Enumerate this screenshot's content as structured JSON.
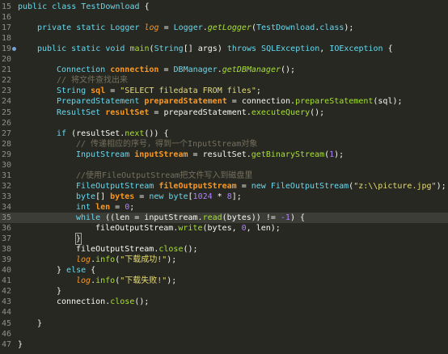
{
  "editor": {
    "language": "java",
    "current_line_number": "35",
    "breakpoint_line_number": "19",
    "lines": [
      {
        "num": "15",
        "indent": 0,
        "tokens": [
          [
            "kw",
            "public"
          ],
          [
            "pl",
            " "
          ],
          [
            "kw",
            "class"
          ],
          [
            "pl",
            " "
          ],
          [
            "cls",
            "TestDownload"
          ],
          [
            "pl",
            " {"
          ]
        ]
      },
      {
        "num": "16",
        "indent": 0,
        "tokens": []
      },
      {
        "num": "17",
        "indent": 1,
        "tokens": [
          [
            "kw",
            "private"
          ],
          [
            "pl",
            " "
          ],
          [
            "kw",
            "static"
          ],
          [
            "pl",
            " "
          ],
          [
            "ty",
            "Logger"
          ],
          [
            "pl",
            " "
          ],
          [
            "fld",
            "log"
          ],
          [
            "pl",
            " = "
          ],
          [
            "ty",
            "Logger"
          ],
          [
            "pl",
            "."
          ],
          [
            "sfn",
            "getLogger"
          ],
          [
            "pl",
            "("
          ],
          [
            "ty",
            "TestDownload"
          ],
          [
            "pl",
            "."
          ],
          [
            "kw",
            "class"
          ],
          [
            "pl",
            ");"
          ]
        ]
      },
      {
        "num": "18",
        "indent": 0,
        "tokens": []
      },
      {
        "num": "19",
        "indent": 1,
        "tokens": [
          [
            "kw",
            "public"
          ],
          [
            "pl",
            " "
          ],
          [
            "kw",
            "static"
          ],
          [
            "pl",
            " "
          ],
          [
            "kw",
            "void"
          ],
          [
            "pl",
            " "
          ],
          [
            "fn",
            "main"
          ],
          [
            "pl",
            "("
          ],
          [
            "ty",
            "String"
          ],
          [
            "pl",
            "[] "
          ],
          [
            "pl",
            "args"
          ],
          [
            "pl",
            ") "
          ],
          [
            "kw",
            "throws"
          ],
          [
            "pl",
            " "
          ],
          [
            "ty",
            "SQLException"
          ],
          [
            "pl",
            ", "
          ],
          [
            "ty",
            "IOException"
          ],
          [
            "pl",
            " {"
          ]
        ]
      },
      {
        "num": "20",
        "indent": 0,
        "tokens": []
      },
      {
        "num": "21",
        "indent": 2,
        "tokens": [
          [
            "ty",
            "Connection"
          ],
          [
            "pl",
            " "
          ],
          [
            "var",
            "connection"
          ],
          [
            "pl",
            " = "
          ],
          [
            "ty",
            "DBManager"
          ],
          [
            "pl",
            "."
          ],
          [
            "sfn",
            "getDBManager"
          ],
          [
            "pl",
            "();"
          ]
        ]
      },
      {
        "num": "22",
        "indent": 2,
        "tokens": [
          [
            "cm",
            "// 将文件查找出来"
          ]
        ]
      },
      {
        "num": "23",
        "indent": 2,
        "tokens": [
          [
            "ty",
            "String"
          ],
          [
            "pl",
            " "
          ],
          [
            "var",
            "sql"
          ],
          [
            "pl",
            " = "
          ],
          [
            "str",
            "\"SELECT filedata FROM files\""
          ],
          [
            "pl",
            ";"
          ]
        ]
      },
      {
        "num": "24",
        "indent": 2,
        "tokens": [
          [
            "ty",
            "PreparedStatement"
          ],
          [
            "pl",
            " "
          ],
          [
            "var",
            "preparedStatement"
          ],
          [
            "pl",
            " = "
          ],
          [
            "pl",
            "connection"
          ],
          [
            "pl",
            "."
          ],
          [
            "fn",
            "prepareStatement"
          ],
          [
            "pl",
            "(sql);"
          ]
        ]
      },
      {
        "num": "25",
        "indent": 2,
        "tokens": [
          [
            "ty",
            "ResultSet"
          ],
          [
            "pl",
            " "
          ],
          [
            "var",
            "resultSet"
          ],
          [
            "pl",
            " = "
          ],
          [
            "pl",
            "preparedStatement"
          ],
          [
            "pl",
            "."
          ],
          [
            "fn",
            "executeQuery"
          ],
          [
            "pl",
            "();"
          ]
        ]
      },
      {
        "num": "26",
        "indent": 0,
        "tokens": []
      },
      {
        "num": "27",
        "indent": 2,
        "tokens": [
          [
            "kw",
            "if"
          ],
          [
            "pl",
            " (resultSet."
          ],
          [
            "fn",
            "next"
          ],
          [
            "pl",
            "()) {"
          ]
        ]
      },
      {
        "num": "28",
        "indent": 3,
        "tokens": [
          [
            "cm",
            "// 传递相应的序号，得到一个InputStream对象"
          ]
        ]
      },
      {
        "num": "29",
        "indent": 3,
        "tokens": [
          [
            "ty",
            "InputStream"
          ],
          [
            "pl",
            " "
          ],
          [
            "var",
            "inputStream"
          ],
          [
            "pl",
            " = "
          ],
          [
            "pl",
            "resultSet"
          ],
          [
            "pl",
            "."
          ],
          [
            "fn",
            "getBinaryStream"
          ],
          [
            "pl",
            "("
          ],
          [
            "num",
            "1"
          ],
          [
            "pl",
            ");"
          ]
        ]
      },
      {
        "num": "30",
        "indent": 0,
        "tokens": []
      },
      {
        "num": "31",
        "indent": 3,
        "tokens": [
          [
            "cm",
            "//使用FileOutputStream把文件写入到磁盘里"
          ]
        ]
      },
      {
        "num": "32",
        "indent": 3,
        "tokens": [
          [
            "ty",
            "FileOutputStream"
          ],
          [
            "pl",
            " "
          ],
          [
            "var",
            "fileOutputStream"
          ],
          [
            "pl",
            " = "
          ],
          [
            "kw",
            "new"
          ],
          [
            "pl",
            " "
          ],
          [
            "ty",
            "FileOutputStream"
          ],
          [
            "pl",
            "("
          ],
          [
            "str",
            "\"z:\\\\picture.jpg\""
          ],
          [
            "pl",
            ");"
          ]
        ]
      },
      {
        "num": "33",
        "indent": 3,
        "tokens": [
          [
            "kw",
            "byte"
          ],
          [
            "pl",
            "[] "
          ],
          [
            "var",
            "bytes"
          ],
          [
            "pl",
            " = "
          ],
          [
            "kw",
            "new"
          ],
          [
            "pl",
            " "
          ],
          [
            "kw",
            "byte"
          ],
          [
            "pl",
            "["
          ],
          [
            "num",
            "1024"
          ],
          [
            "pl",
            " * "
          ],
          [
            "num",
            "8"
          ],
          [
            "pl",
            "];"
          ]
        ]
      },
      {
        "num": "34",
        "indent": 3,
        "tokens": [
          [
            "kw",
            "int"
          ],
          [
            "pl",
            " "
          ],
          [
            "var",
            "len"
          ],
          [
            "pl",
            " = "
          ],
          [
            "num",
            "0"
          ],
          [
            "pl",
            ";"
          ]
        ]
      },
      {
        "num": "35",
        "indent": 3,
        "tokens": [
          [
            "kw",
            "while"
          ],
          [
            "pl",
            " ((len = "
          ],
          [
            "pl",
            "inputStream"
          ],
          [
            "pl",
            "."
          ],
          [
            "fn",
            "read"
          ],
          [
            "pl",
            "(bytes)) != "
          ],
          [
            "num",
            "-1"
          ],
          [
            "pl",
            ") {"
          ]
        ]
      },
      {
        "num": "36",
        "indent": 4,
        "tokens": [
          [
            "pl",
            "fileOutputStream"
          ],
          [
            "pl",
            "."
          ],
          [
            "fn",
            "write"
          ],
          [
            "pl",
            "(bytes, "
          ],
          [
            "num",
            "0"
          ],
          [
            "pl",
            ", len);"
          ]
        ]
      },
      {
        "num": "37",
        "indent": 3,
        "tokens": [
          [
            "caret",
            "}"
          ]
        ]
      },
      {
        "num": "38",
        "indent": 3,
        "tokens": [
          [
            "pl",
            "fileOutputStream"
          ],
          [
            "pl",
            "."
          ],
          [
            "fn",
            "close"
          ],
          [
            "pl",
            "();"
          ]
        ]
      },
      {
        "num": "39",
        "indent": 3,
        "tokens": [
          [
            "fld",
            "log"
          ],
          [
            "pl",
            "."
          ],
          [
            "fn",
            "info"
          ],
          [
            "pl",
            "("
          ],
          [
            "str",
            "\"下载成功!\""
          ],
          [
            "pl",
            ");"
          ]
        ]
      },
      {
        "num": "40",
        "indent": 2,
        "tokens": [
          [
            "pl",
            "} "
          ],
          [
            "kw",
            "else"
          ],
          [
            "pl",
            " {"
          ]
        ]
      },
      {
        "num": "41",
        "indent": 3,
        "tokens": [
          [
            "fld",
            "log"
          ],
          [
            "pl",
            "."
          ],
          [
            "fn",
            "info"
          ],
          [
            "pl",
            "("
          ],
          [
            "str",
            "\"下载失败!\""
          ],
          [
            "pl",
            ");"
          ]
        ]
      },
      {
        "num": "42",
        "indent": 2,
        "tokens": [
          [
            "pl",
            "}"
          ]
        ]
      },
      {
        "num": "43",
        "indent": 2,
        "tokens": [
          [
            "pl",
            "connection"
          ],
          [
            "pl",
            "."
          ],
          [
            "fn",
            "close"
          ],
          [
            "pl",
            "();"
          ]
        ]
      },
      {
        "num": "44",
        "indent": 0,
        "tokens": []
      },
      {
        "num": "45",
        "indent": 1,
        "tokens": [
          [
            "pl",
            "}"
          ]
        ]
      },
      {
        "num": "46",
        "indent": 0,
        "tokens": []
      },
      {
        "num": "47",
        "indent": 0,
        "tokens": [
          [
            "pl",
            "}"
          ]
        ]
      }
    ]
  },
  "colors": {
    "background": "#272822",
    "current_line": "#3c3d37",
    "keyword": "#66d9ef",
    "variable": "#fd971f",
    "method": "#a6e22e",
    "string": "#e6db74",
    "number": "#ae81ff",
    "comment": "#75715e",
    "breakpoint_marker": "#75a3d9"
  }
}
